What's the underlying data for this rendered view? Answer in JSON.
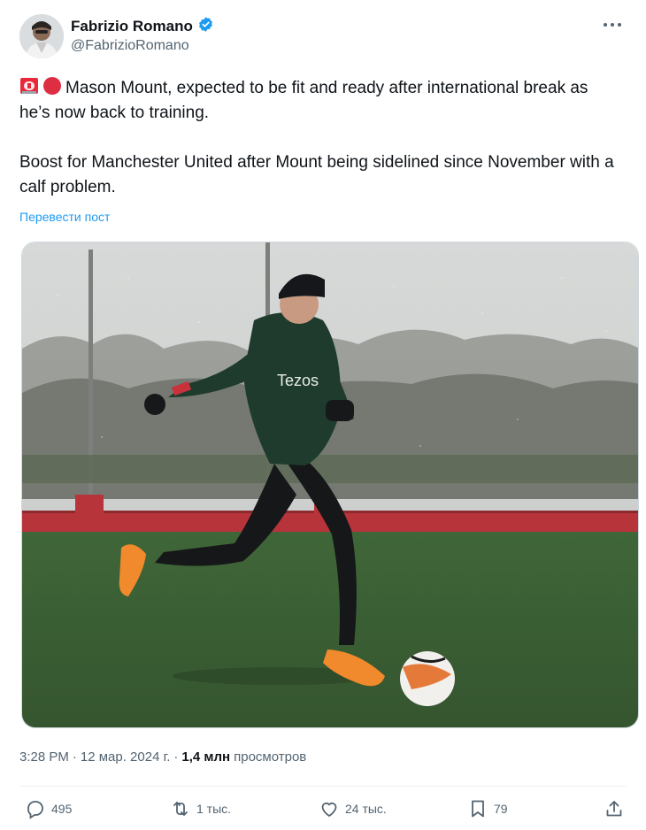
{
  "author": {
    "name": "Fabrizio Romano",
    "handle": "@FabrizioRomano",
    "verified": true,
    "verified_color": "#1d9bf0"
  },
  "tweet": {
    "line1": "Mason Mount, expected to be fit and ready after international break as he’s now back to training.",
    "line2": "Boost for Manchester United after Mount being sidelined since November with a calf problem.",
    "translate_label": "Перевести пост",
    "emojis": [
      "rotating-light-icon",
      "red-circle-icon"
    ]
  },
  "media": {
    "image_label": "Player in green training top and black beanie kicking football on training pitch",
    "shirt_text": "Tezos"
  },
  "meta": {
    "time": "3:28 PM",
    "separator": "·",
    "date": "12 мар. 2024 г.",
    "views_count": "1,4 млн",
    "views_label": "просмотров"
  },
  "actions": {
    "replies": "495",
    "reposts": "1 тыс.",
    "likes": "24 тыс.",
    "bookmarks": "79"
  },
  "colors": {
    "accent": "#1d9bf0",
    "secondary_text": "#536471",
    "primary_text": "#0f1419"
  }
}
